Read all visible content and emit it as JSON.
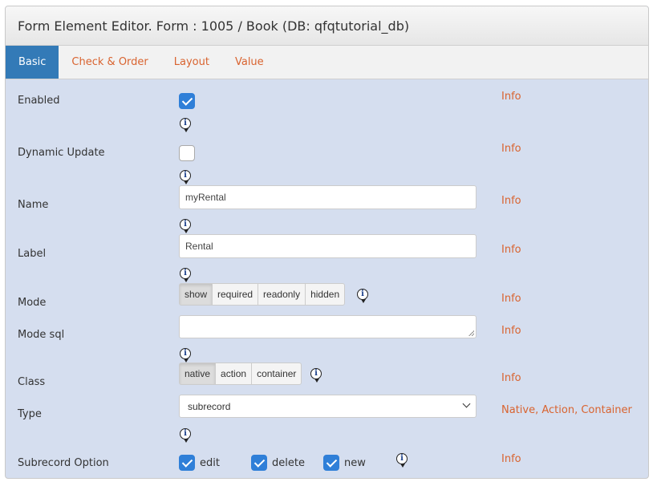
{
  "header": {
    "title": "Form Element Editor. Form : 1005 / Book (DB: qfqtutorial_db)"
  },
  "tabs": [
    {
      "label": "Basic",
      "active": true
    },
    {
      "label": "Check & Order",
      "active": false
    },
    {
      "label": "Layout",
      "active": false
    },
    {
      "label": "Value",
      "active": false
    }
  ],
  "info_label": "Info",
  "info_icon_glyph": "i",
  "fields": {
    "enabled": {
      "label": "Enabled",
      "checked": true
    },
    "dynamic_update": {
      "label": "Dynamic Update",
      "checked": false
    },
    "name": {
      "label": "Name",
      "value": "myRental"
    },
    "label": {
      "label": "Label",
      "value": "Rental"
    },
    "mode": {
      "label": "Mode",
      "options": [
        "show",
        "required",
        "readonly",
        "hidden"
      ],
      "selected": "show"
    },
    "mode_sql": {
      "label": "Mode sql",
      "value": ""
    },
    "class": {
      "label": "Class",
      "options": [
        "native",
        "action",
        "container"
      ],
      "selected": "native"
    },
    "type": {
      "label": "Type",
      "value": "subrecord",
      "info_links": [
        "Native",
        "Action",
        "Container"
      ]
    },
    "subrecord_option": {
      "label": "Subrecord Option",
      "options": [
        {
          "label": "edit",
          "checked": true
        },
        {
          "label": "delete",
          "checked": true
        },
        {
          "label": "new",
          "checked": true
        }
      ]
    }
  },
  "colors": {
    "accent": "#337ab7",
    "link": "#d9632f",
    "background": "#d5deef",
    "checkbox": "#2f7fd8"
  },
  "icons": {
    "info": "info-bubble-icon",
    "check": "checkmark-icon",
    "dropdown": "chevron-down-icon"
  }
}
